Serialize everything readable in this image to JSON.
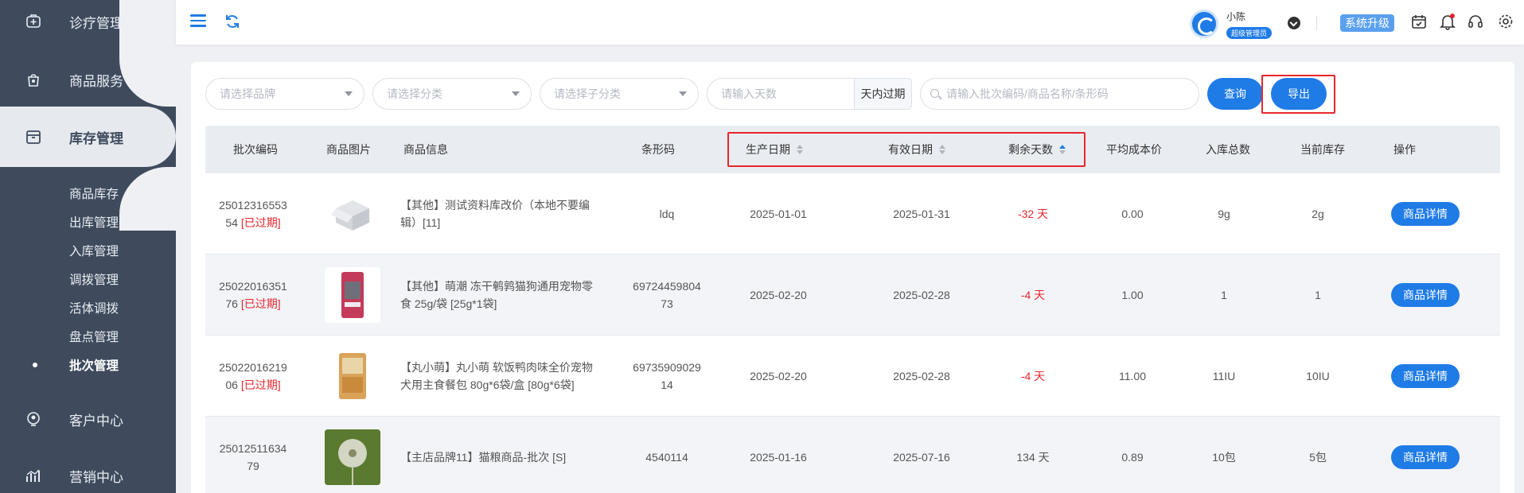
{
  "sidebar": {
    "items": [
      {
        "label": "诊疗管理",
        "icon": "medical-kit-icon"
      },
      {
        "label": "商品服务",
        "icon": "bag-icon"
      },
      {
        "label": "库存管理",
        "icon": "warehouse-box-icon"
      },
      {
        "label": "客户中心",
        "icon": "customer-icon"
      },
      {
        "label": "营销中心",
        "icon": "chart-icon"
      }
    ],
    "subitems": [
      {
        "label": "商品库存"
      },
      {
        "label": "出库管理"
      },
      {
        "label": "入库管理"
      },
      {
        "label": "调拨管理"
      },
      {
        "label": "活体调拨"
      },
      {
        "label": "盘点管理"
      },
      {
        "label": "批次管理"
      }
    ]
  },
  "header": {
    "user_name": "小陈",
    "user_role": "超级管理员",
    "upgrade_label": "系统升级"
  },
  "filters": {
    "brand_placeholder": "请选择品牌",
    "category_placeholder": "请选择分类",
    "subcategory_placeholder": "请选择子分类",
    "days_placeholder": "请输入天数",
    "days_suffix": "天内过期",
    "search_placeholder": "请输入批次编码/商品名称/条形码",
    "query_label": "查询",
    "export_label": "导出"
  },
  "table": {
    "headers": {
      "batch": "批次编码",
      "image": "商品图片",
      "info": "商品信息",
      "barcode": "条形码",
      "prod_date": "生产日期",
      "expiry": "有效日期",
      "remaining": "剩余天数",
      "avg_cost": "平均成本价",
      "in_total": "入库总数",
      "stock": "当前库存",
      "action": "操作"
    },
    "rows": [
      {
        "batch_l1": "25012316553",
        "batch_l2": "54",
        "status": "[已过期]",
        "info_l1": "【其他】测试资料库改价（本地不要编",
        "info_l2": "辑）[11]",
        "barcode_l1": "ldq",
        "barcode_l2": "",
        "prod_date": "2025-01-01",
        "expiry": "2025-01-31",
        "remaining": "-32 天",
        "avg_cost": "0.00",
        "in_total": "9g",
        "stock": "2g",
        "action": "商品详情"
      },
      {
        "batch_l1": "25022016351",
        "batch_l2": "76",
        "status": "[已过期]",
        "info_l1": "【其他】萌潮 冻干鹌鹑猫狗通用宠物零",
        "info_l2": "食 25g/袋 [25g*1袋]",
        "barcode_l1": "69724459804",
        "barcode_l2": "73",
        "prod_date": "2025-02-20",
        "expiry": "2025-02-28",
        "remaining": "-4 天",
        "avg_cost": "1.00",
        "in_total": "1",
        "stock": "1",
        "action": "商品详情"
      },
      {
        "batch_l1": "25022016219",
        "batch_l2": "06",
        "status": "[已过期]",
        "info_l1": "【丸小萌】丸小萌 软饭鸭肉味全价宠物",
        "info_l2": "犬用主食餐包 80g*6袋/盒 [80g*6袋]",
        "barcode_l1": "69735909029",
        "barcode_l2": "14",
        "prod_date": "2025-02-20",
        "expiry": "2025-02-28",
        "remaining": "-4 天",
        "avg_cost": "11.00",
        "in_total": "11IU",
        "stock": "10IU",
        "action": "商品详情"
      },
      {
        "batch_l1": "25012511634",
        "batch_l2": "79",
        "status": "",
        "info_l1": "【主店品牌11】猫粮商品-批次 [S]",
        "info_l2": "",
        "barcode_l1": "4540114",
        "barcode_l2": "",
        "prod_date": "2025-01-16",
        "expiry": "2025-07-16",
        "remaining": "134 天",
        "avg_cost": "0.89",
        "in_total": "10包",
        "stock": "5包",
        "action": "商品详情"
      }
    ]
  },
  "colors": {
    "primary": "#1f7be6",
    "sidebar": "#3f4b5d",
    "danger": "#e8262c"
  }
}
